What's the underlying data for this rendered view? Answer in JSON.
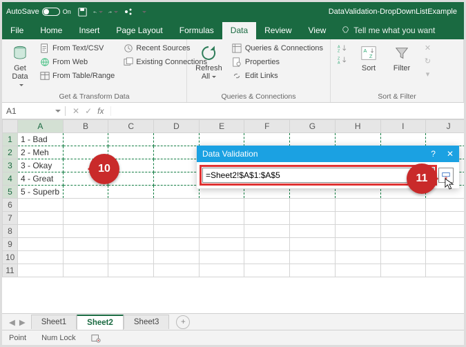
{
  "titlebar": {
    "autosave_label": "AutoSave",
    "autosave_state": "On",
    "document_name": "DataValidation-DropDownListExample"
  },
  "tabs": {
    "file": "File",
    "home": "Home",
    "insert": "Insert",
    "page_layout": "Page Layout",
    "formulas": "Formulas",
    "data": "Data",
    "review": "Review",
    "view": "View",
    "tell_me": "Tell me what you want"
  },
  "ribbon": {
    "get_data": "Get Data",
    "from_text": "From Text/CSV",
    "from_web": "From Web",
    "from_table": "From Table/Range",
    "recent_sources": "Recent Sources",
    "existing_conn": "Existing Connections",
    "group_get": "Get & Transform Data",
    "refresh_all": "Refresh All",
    "queries": "Queries & Connections",
    "properties": "Properties",
    "edit_links": "Edit Links",
    "group_conn": "Queries & Connections",
    "sort": "Sort",
    "filter": "Filter",
    "group_sort": "Sort & Filter"
  },
  "namebox": {
    "value": "A1"
  },
  "columns": [
    "A",
    "B",
    "C",
    "D",
    "E",
    "F",
    "G",
    "H",
    "I",
    "J"
  ],
  "rows_shown": 11,
  "cells": {
    "a1": "1 - Bad",
    "a2": "2 - Meh",
    "a3": "3 - Okay",
    "a4": "4 - Great",
    "a5": "5 - Superb"
  },
  "dialog": {
    "title": "Data Validation",
    "formula": "=Sheet2!$A$1:$A$5"
  },
  "callouts": {
    "c10": "10",
    "c11": "11"
  },
  "sheets": {
    "s1": "Sheet1",
    "s2": "Sheet2",
    "s3": "Sheet3"
  },
  "status": {
    "mode": "Point",
    "numlock": "Num Lock"
  }
}
